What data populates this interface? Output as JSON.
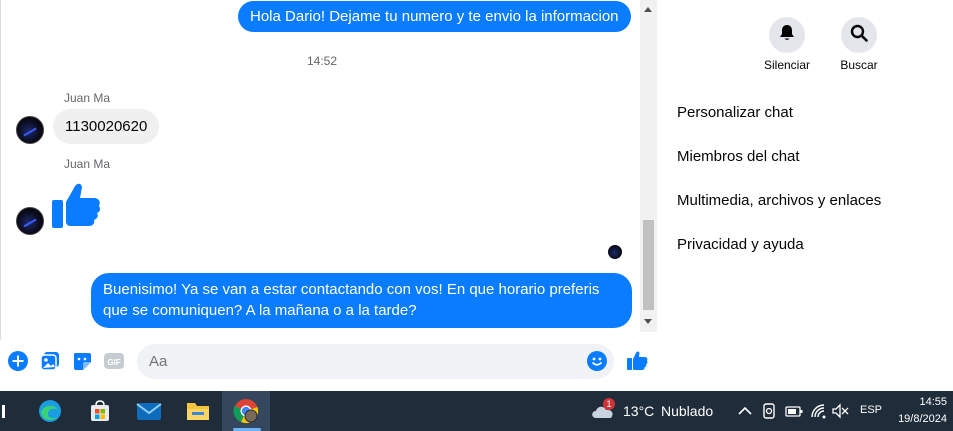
{
  "chat": {
    "messages": [
      {
        "type": "out",
        "text": "Hola Dario! Dejame tu numero y te envio la informacion"
      },
      {
        "type": "time",
        "text": "14:52"
      },
      {
        "type": "in",
        "sender": "Juan Ma",
        "text": "1130020620"
      },
      {
        "type": "in-like",
        "sender": "Juan Ma"
      },
      {
        "type": "out",
        "text": "Buenisimo! Ya se van a estar contactando con vos! En que horario preferis que se comuniquen? A la mañana o a la tarde?"
      }
    ],
    "composer": {
      "placeholder": "Aa"
    },
    "colors": {
      "accent": "#0a7cff"
    }
  },
  "panel": {
    "actions": [
      {
        "label": "Silenciar",
        "icon": "bell-icon"
      },
      {
        "label": "Buscar",
        "icon": "search-icon"
      }
    ],
    "menu": [
      "Personalizar chat",
      "Miembros del chat",
      "Multimedia, archivos y enlaces",
      "Privacidad y ayuda"
    ]
  },
  "taskbar": {
    "weather": {
      "temp": "13°C",
      "condition": "Nublado",
      "badge": "1"
    },
    "language": "ESP",
    "time": "14:55",
    "date": "19/8/2024"
  }
}
